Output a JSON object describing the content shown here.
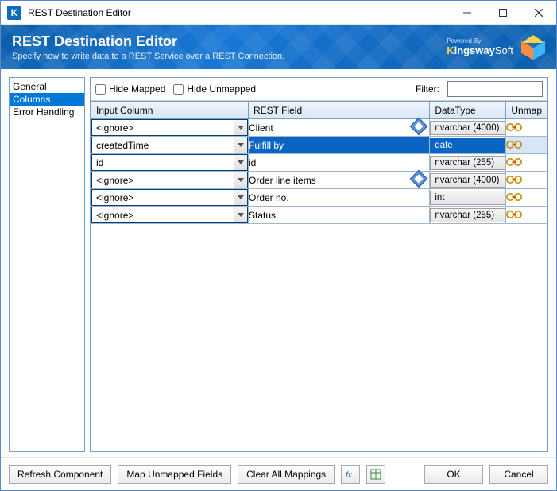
{
  "window": {
    "title": "REST Destination Editor"
  },
  "banner": {
    "title": "REST Destination Editor",
    "subtitle": "Specify how to write data to a REST Service over a REST Connection.",
    "powered_by": "Powered By",
    "brand": "KingswaySoft"
  },
  "sidebar": {
    "items": [
      {
        "label": "General",
        "selected": false
      },
      {
        "label": "Columns",
        "selected": true
      },
      {
        "label": "Error Handling",
        "selected": false
      }
    ]
  },
  "toolbar": {
    "hide_mapped_label": "Hide Mapped",
    "hide_unmapped_label": "Hide Unmapped",
    "filter_label": "Filter:",
    "filter_value": ""
  },
  "table": {
    "headers": {
      "input": "Input Column",
      "rest": "REST Field",
      "datatype": "DataType",
      "unmap": "Unmap"
    },
    "rows": [
      {
        "input": "<ignore>",
        "rest": "Client",
        "key": true,
        "dtype": "nvarchar (4000)",
        "selected": false
      },
      {
        "input": "createdTime",
        "rest": "Fulfill by",
        "key": false,
        "dtype": "date",
        "selected": true
      },
      {
        "input": "id",
        "rest": "id",
        "key": false,
        "dtype": "nvarchar (255)",
        "selected": false
      },
      {
        "input": "<ignore>",
        "rest": "Order line items",
        "key": true,
        "dtype": "nvarchar (4000)",
        "selected": false
      },
      {
        "input": "<ignore>",
        "rest": "Order no.",
        "key": false,
        "dtype": "int",
        "selected": false
      },
      {
        "input": "<ignore>",
        "rest": "Status",
        "key": false,
        "dtype": "nvarchar (255)",
        "selected": false
      }
    ]
  },
  "footer": {
    "refresh": "Refresh Component",
    "map_unmapped": "Map Unmapped Fields",
    "clear_all": "Clear All Mappings",
    "ok": "OK",
    "cancel": "Cancel"
  }
}
